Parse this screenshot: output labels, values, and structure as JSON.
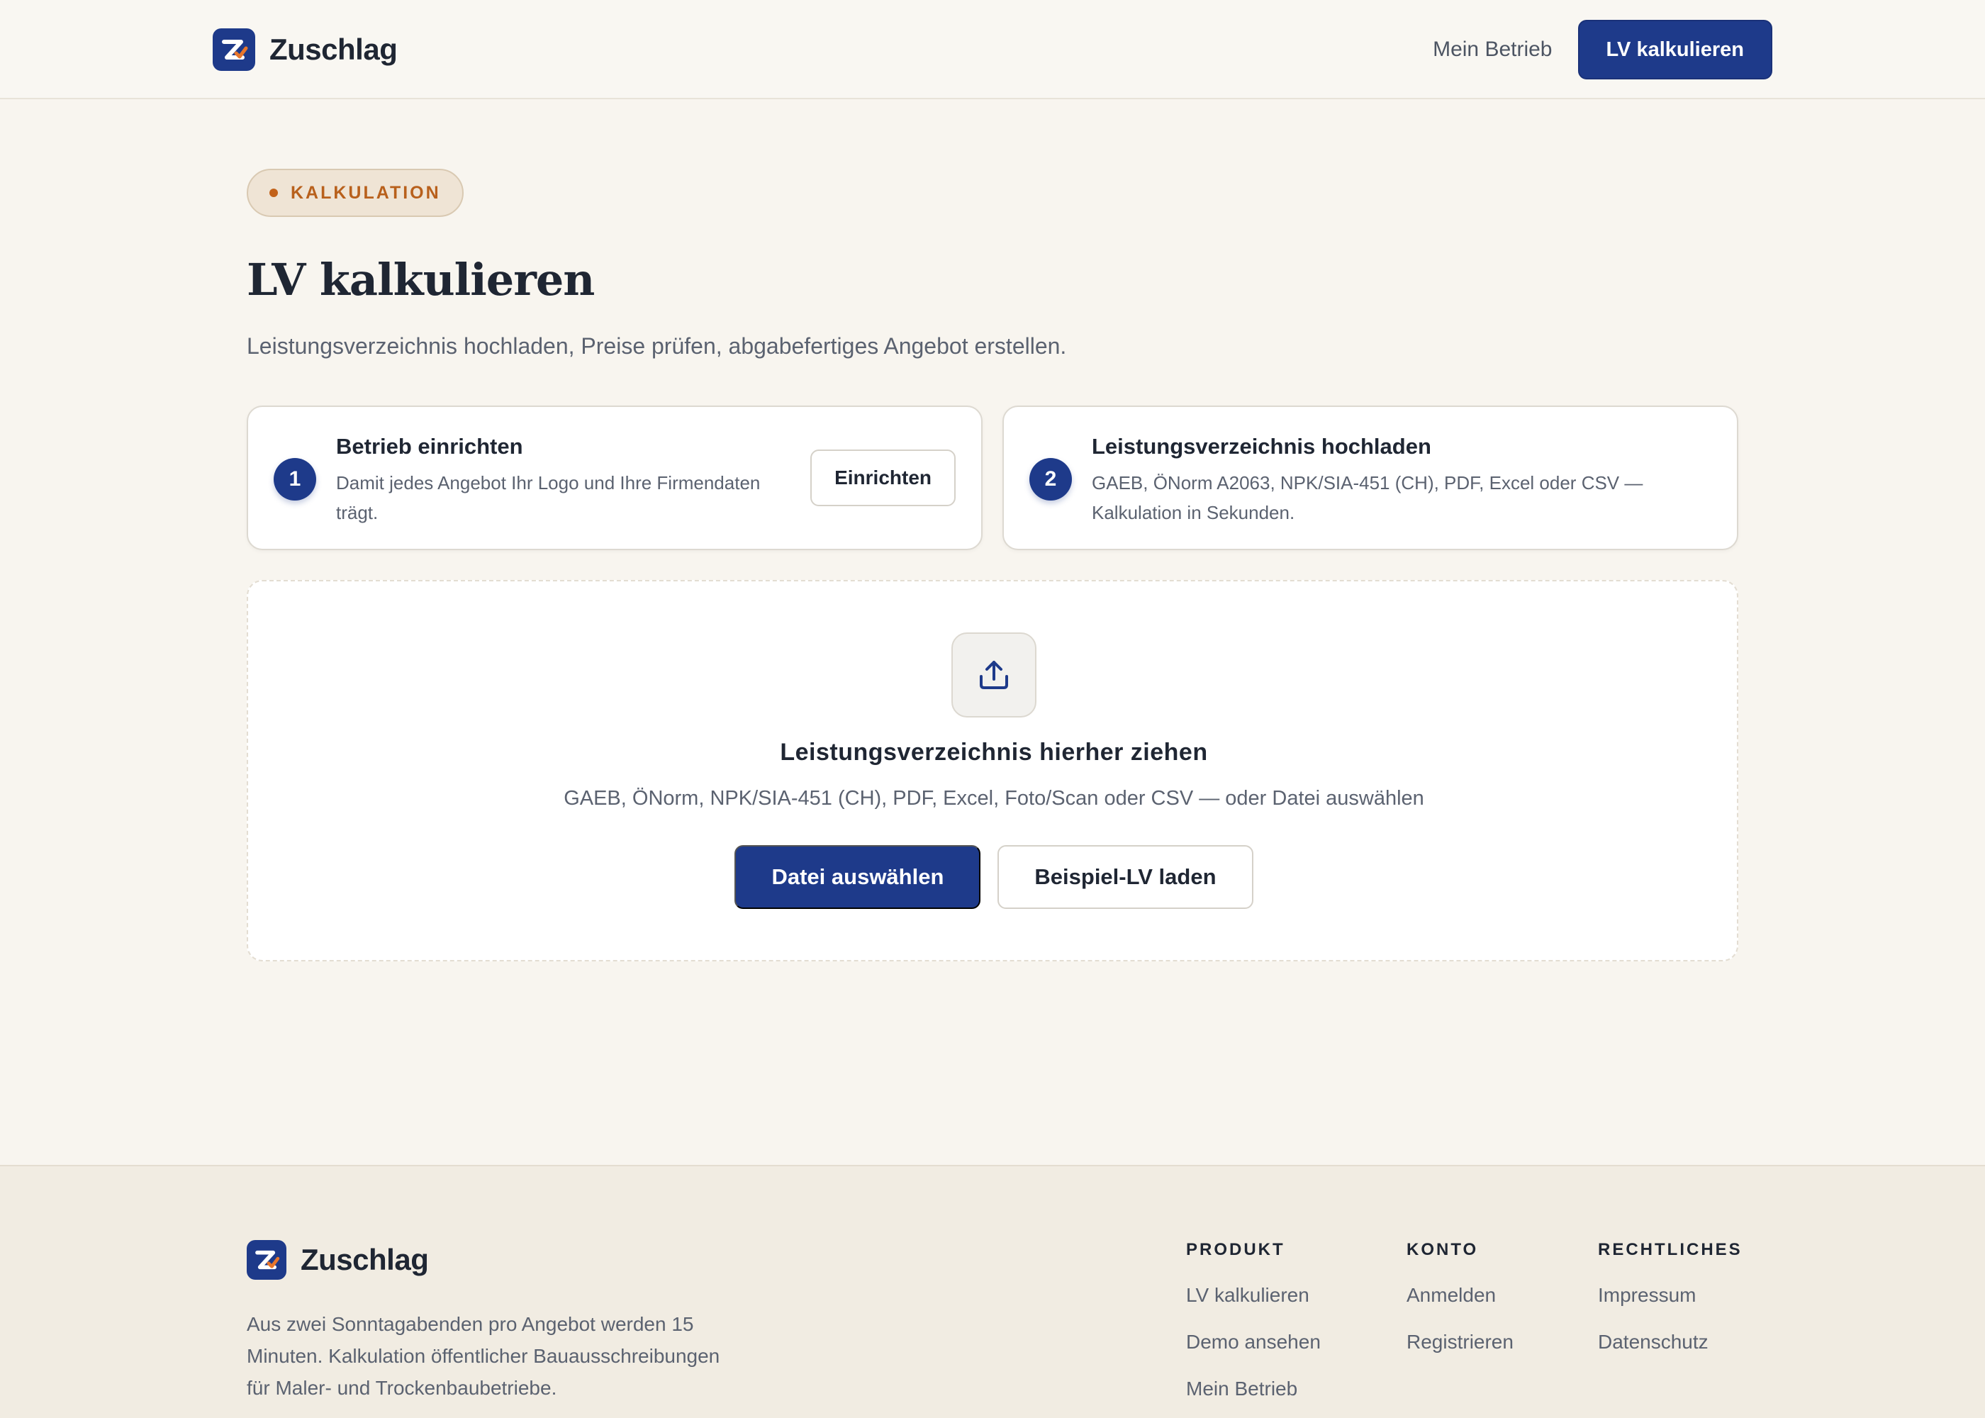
{
  "brand": {
    "name": "Zuschlag",
    "logo_icon": "z-checkmark-logo"
  },
  "header": {
    "nav_link": "Mein Betrieb",
    "cta_label": "LV kalkulieren"
  },
  "main": {
    "eyebrow": "KALKULATION",
    "title": "LV kalkulieren",
    "subtitle": "Leistungsverzeichnis hochladen, Preise prüfen, abgabefertiges Angebot erstellen.",
    "steps": [
      {
        "number": "1",
        "title": "Betrieb einrichten",
        "description": "Damit jedes Angebot Ihr Logo und Ihre Firmendaten trägt.",
        "button": "Einrichten"
      },
      {
        "number": "2",
        "title": "Leistungsverzeichnis hochladen",
        "description": "GAEB, ÖNorm A2063, NPK/SIA-451 (CH), PDF, Excel oder CSV — Kalkulation in Sekunden."
      }
    ],
    "dropzone": {
      "icon": "upload-icon",
      "title": "Leistungsverzeichnis hierher ziehen",
      "hint": "GAEB, ÖNorm, NPK/SIA-451 (CH), PDF, Excel, Foto/Scan oder CSV — oder Datei auswählen",
      "primary_button": "Datei auswählen",
      "secondary_button": "Beispiel-LV laden"
    }
  },
  "footer": {
    "tagline": "Aus zwei Sonntagabenden pro Angebot werden 15 Minuten. Kalkulation öffentlicher Bauausschreibungen für Maler- und Trockenbaubetriebe.",
    "columns": [
      {
        "title": "PRODUKT",
        "links": [
          "LV kalkulieren",
          "Demo ansehen",
          "Mein Betrieb"
        ]
      },
      {
        "title": "KONTO",
        "links": [
          "Anmelden",
          "Registrieren"
        ]
      },
      {
        "title": "RECHTLICHES",
        "links": [
          "Impressum",
          "Datenschutz"
        ]
      }
    ]
  },
  "colors": {
    "accent": "#1e3a8a",
    "eyebrow_text": "#b8601c",
    "background": "#f8f5ef"
  }
}
